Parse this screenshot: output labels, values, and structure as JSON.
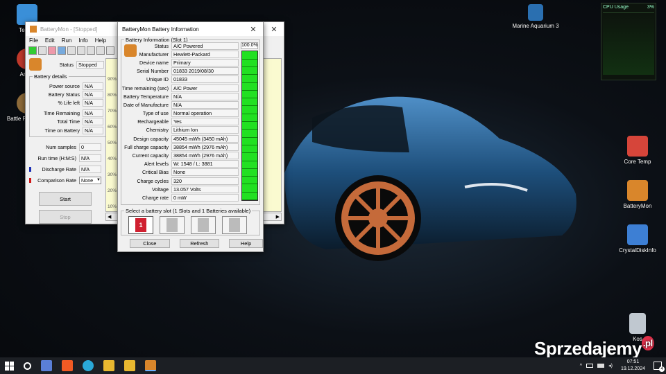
{
  "desktop": {
    "icons_left": [
      {
        "label": "Ten ko",
        "color": "#3a8fd8"
      },
      {
        "label": "Angry",
        "color": "#c0392b"
      },
      {
        "label": "Battle F Judgem",
        "color": "#8e6b3a"
      }
    ],
    "icons_right": [
      {
        "label": "Marine Aquarium 3",
        "color": "#2a6fb0"
      },
      {
        "label": "Core Temp",
        "color": "#d6453a"
      },
      {
        "label": "BatteryMon",
        "color": "#d9862b"
      },
      {
        "label": "CrystalDiskInfo",
        "color": "#3d7fd4"
      },
      {
        "label": "Kos",
        "color": "#c0c8d0"
      }
    ],
    "watermark": "Sprzedajemy",
    "watermark_suffix": ".pl"
  },
  "cpu_widget": {
    "title": "CPU Usage",
    "percent": "3%"
  },
  "batterymon_main": {
    "title": "BatteryMon - [Stopped]",
    "menu": [
      "File",
      "Edit",
      "Run",
      "Info",
      "Help"
    ],
    "status_label": "Status",
    "status_value": "Stopped",
    "details_legend": "Battery details",
    "details": [
      {
        "label": "Power source",
        "value": "N/A"
      },
      {
        "label": "Battery Status",
        "value": "N/A"
      },
      {
        "label": "% Life left",
        "value": "N/A"
      },
      {
        "label": "Time Remaining",
        "value": "N/A"
      },
      {
        "label": "Total Time",
        "value": "N/A"
      },
      {
        "label": "Time on Battery",
        "value": "N/A"
      }
    ],
    "stats": [
      {
        "label": "Num samples",
        "value": "0"
      },
      {
        "label": "Run time (H:M:S)",
        "value": "N/A"
      },
      {
        "label": "Discharge Rate",
        "value": "N/A"
      },
      {
        "label": "Comparison Rate",
        "value": "None"
      }
    ],
    "start_label": "Start",
    "stop_label": "Stop",
    "graph_ticks": [
      "90%",
      "80%",
      "70%",
      "60%",
      "50%",
      "40%",
      "30%",
      "20%",
      "10%"
    ]
  },
  "battery_info": {
    "title": "BatteryMon Battery Information",
    "slot_legend": "Battery Information (Slot 1)",
    "fields": [
      {
        "label": "Status",
        "value": "A/C Powered"
      },
      {
        "label": "Manufacturer",
        "value": "Hewlett-Packard"
      },
      {
        "label": "Device name",
        "value": "Primary"
      },
      {
        "label": "Serial Number",
        "value": "01833 2019/08/30"
      },
      {
        "label": "Unique ID",
        "value": "01833"
      },
      {
        "label": "Time remaining (sec)",
        "value": "A/C Power"
      },
      {
        "label": "Battery Temperature",
        "value": "N/A"
      },
      {
        "label": "Date of Manufacture",
        "value": "N/A"
      },
      {
        "label": "Type of use",
        "value": "Normal operation"
      },
      {
        "label": "Rechargeable",
        "value": "Yes"
      },
      {
        "label": "Chemistry",
        "value": "Lithium Ion"
      },
      {
        "label": "Design capacity",
        "value": "45045 mWh (3450 mAh)"
      },
      {
        "label": "Full charge capacity",
        "value": "38854 mWh (2976 mAh)"
      },
      {
        "label": "Current capacity",
        "value": "38854 mWh (2976 mAh)"
      },
      {
        "label": "Alert levels",
        "value": "W: 1548 / L: 3881"
      },
      {
        "label": "Critical Bias",
        "value": "None"
      },
      {
        "label": "Charge cycles",
        "value": "320"
      },
      {
        "label": "Voltage",
        "value": "13.057 Volts"
      },
      {
        "label": "Charge rate",
        "value": "0 mW"
      }
    ],
    "charge_percent_label": "100.0%",
    "charge_fraction": 1.0,
    "slot_select_legend": "Select a battery slot (1 Slots and 1 Batteries available)",
    "slots": [
      "1",
      "",
      "",
      ""
    ],
    "close_label": "Close",
    "refresh_label": "Refresh",
    "help_label": "Help"
  },
  "taskbar": {
    "time": "07:51",
    "date": "19.12.2024",
    "notification_count": "4"
  }
}
